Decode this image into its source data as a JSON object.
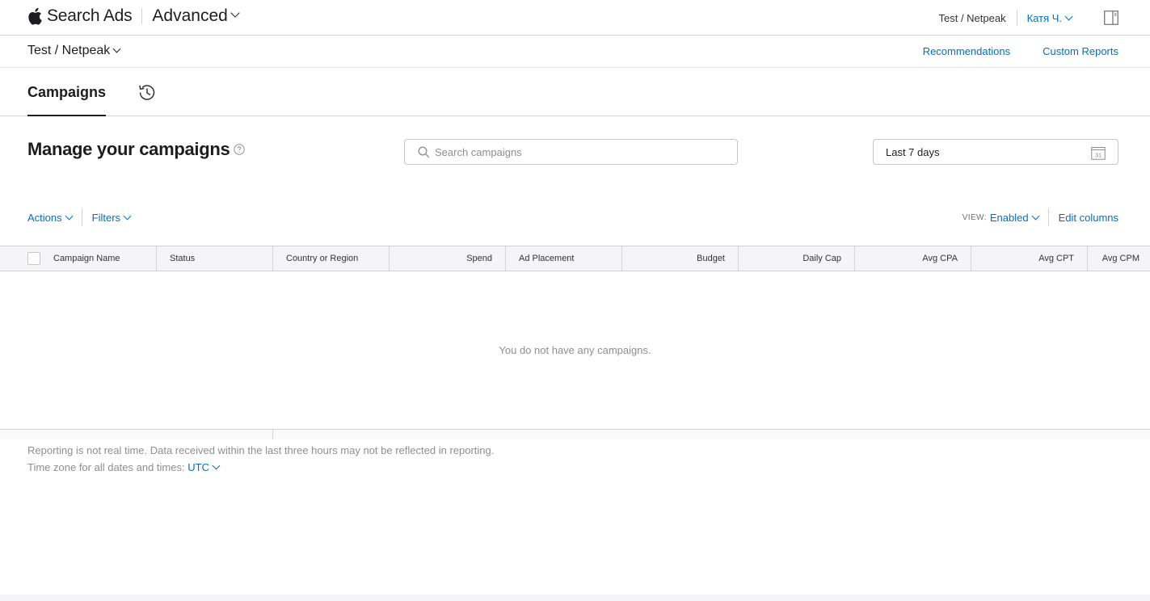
{
  "header": {
    "brand_name": "Search Ads",
    "brand_tier": "Advanced",
    "org": "Test / Netpeak",
    "user": "Катя Ч."
  },
  "subbar": {
    "account": "Test / Netpeak",
    "links": [
      "Recommendations",
      "Custom Reports"
    ]
  },
  "tabs": {
    "campaigns": "Campaigns"
  },
  "main": {
    "title": "Manage your campaigns",
    "search_placeholder": "Search campaigns",
    "date_range": "Last 7 days",
    "calendar_day": "31"
  },
  "toolbar": {
    "actions": "Actions",
    "filters": "Filters",
    "view_label": "VIEW:",
    "view_value": "Enabled",
    "edit_columns": "Edit columns"
  },
  "table": {
    "columns": [
      "Campaign Name",
      "Status",
      "Country or Region",
      "Spend",
      "Ad Placement",
      "Budget",
      "Daily Cap",
      "Avg CPA",
      "Avg CPT",
      "Avg CPM"
    ],
    "empty_message": "You do not have any campaigns."
  },
  "footer": {
    "note": "Reporting is not real time. Data received within the last three hours may not be reflected in reporting.",
    "timezone_label": "Time zone for all dates and times:",
    "timezone_value": "UTC"
  },
  "icons": {
    "logo": "apple-logo-icon",
    "panel": "sidebar-panel-icon",
    "history": "history-icon",
    "help": "help-icon",
    "search": "search-icon",
    "calendar": "calendar-icon"
  },
  "colors": {
    "link": "#0070c9",
    "border": "#d2d2d7",
    "header_bg": "#f5f5f7",
    "muted_text": "#8e8e93"
  }
}
